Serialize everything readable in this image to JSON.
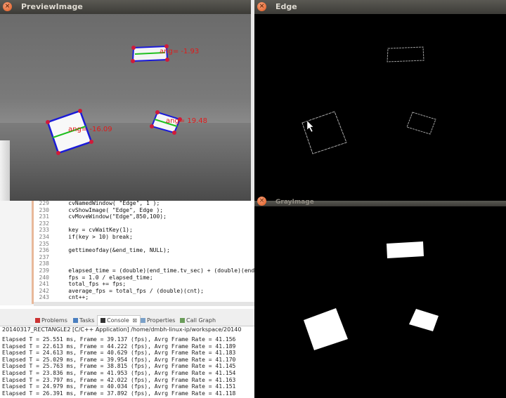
{
  "colors": {
    "titlebar": "#3c3b37",
    "title_text": "#dfdbd2",
    "close_button": "#e05a1f",
    "rect_outline": "#1a1ad8",
    "corner_dot": "#d01a3a",
    "angle_line": "#20c020",
    "angle_text": "#e01a1a",
    "keyword": "#7f0055"
  },
  "preview_window": {
    "title": "PreviewImage",
    "labels": [
      {
        "text": "ang=",
        "value": "-1.93"
      },
      {
        "text": "ang=",
        "value": "-16.09"
      },
      {
        "text": "ang=",
        "value": "19.48"
      }
    ]
  },
  "edge_window": {
    "title": "Edge"
  },
  "gray_window": {
    "title": "GrayImage"
  },
  "window_buttons": {
    "close": "×",
    "minimize": "",
    "maximize": ""
  },
  "editor": {
    "line_numbers": [
      "229",
      "230",
      "231",
      "232",
      "233",
      "234",
      "235",
      "236",
      "237",
      "238",
      "239",
      "240",
      "241",
      "242",
      "243"
    ],
    "lines": [
      "    cvNamedWindow( \"Edge\", 1 );",
      "    cvShowImage( \"Edge\", Edge );",
      "    cvMoveWindow(\"Edge\",850,100);",
      "",
      "    key = cvWaitKey(1);",
      "    if(key > 10) break;",
      "",
      "    gettimeofday(&end_time, NULL);",
      "",
      "",
      "    elapsed_time = (double)(end_time.tv_sec) + (double)(end_",
      "    fps = 1.0 / elapsed_time;",
      "    total_fps += fps;",
      "    average_fps = total_fps / (double)(cnt);",
      "    cnt++;"
    ]
  },
  "console": {
    "tabs": [
      {
        "label": "Problems",
        "active": false
      },
      {
        "label": "Tasks",
        "active": false
      },
      {
        "label": "Console",
        "active": true,
        "close": "⊠"
      },
      {
        "label": "Properties",
        "active": false
      },
      {
        "label": "Call Graph",
        "active": false
      }
    ],
    "launch": "20140317_RECTANGLE2 [C/C++ Application] /home/dmbh-linux-ip/workspace/20140",
    "lines": [
      "Elapsed T = 25.551 ms, Frame = 39.137 (fps), Avrg Frame Rate = 41.156",
      "Elapsed T = 22.613 ms, Frame = 44.222 (fps), Avrg Frame Rate = 41.189",
      "Elapsed T = 24.613 ms, Frame = 40.629 (fps), Avrg Frame Rate = 41.183",
      "Elapsed T = 25.029 ms, Frame = 39.954 (fps), Avrg Frame Rate = 41.170",
      "Elapsed T = 25.763 ms, Frame = 38.815 (fps), Avrg Frame Rate = 41.145",
      "Elapsed T = 23.836 ms, Frame = 41.953 (fps), Avrg Frame Rate = 41.154",
      "Elapsed T = 23.797 ms, Frame = 42.022 (fps), Avrg Frame Rate = 41.163",
      "Elapsed T = 24.979 ms, Frame = 40.034 (fps), Avrg Frame Rate = 41.151",
      "Elapsed T = 26.391 ms, Frame = 37.892 (fps), Avrg Frame Rate = 41.118"
    ]
  }
}
